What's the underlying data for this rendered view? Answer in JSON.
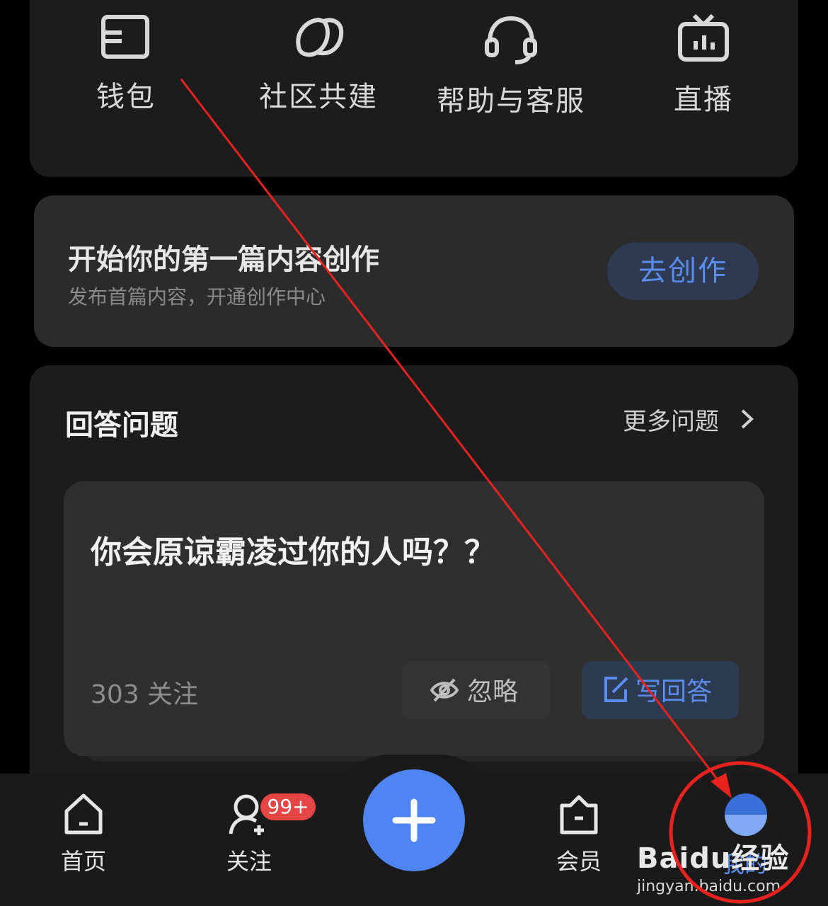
{
  "shortcuts": [
    {
      "label": "钱包",
      "icon": "wallet-icon"
    },
    {
      "label": "社区共建",
      "icon": "leaf-icon"
    },
    {
      "label": "帮助与客服",
      "icon": "headset-icon"
    },
    {
      "label": "直播",
      "icon": "tv-icon"
    }
  ],
  "create": {
    "title": "开始你的第一篇内容创作",
    "subtitle": "发布首篇内容，开通创作中心",
    "button": "去创作"
  },
  "qa": {
    "title": "回答问题",
    "more": "更多问题",
    "question": "你会原谅霸凌过你的人吗？？",
    "follow_count": "303 关注",
    "ignore": "忽略",
    "answer": "写回答"
  },
  "tabbar": {
    "home": "首页",
    "follow": "关注",
    "badge": "99+",
    "member": "会员",
    "me": "我的"
  },
  "watermark": {
    "logo": "Baidu经验",
    "url": "jingyan.baidu.com"
  },
  "colors": {
    "accent": "#5b8def",
    "annotation": "#e8231f",
    "badge": "#e64545"
  }
}
